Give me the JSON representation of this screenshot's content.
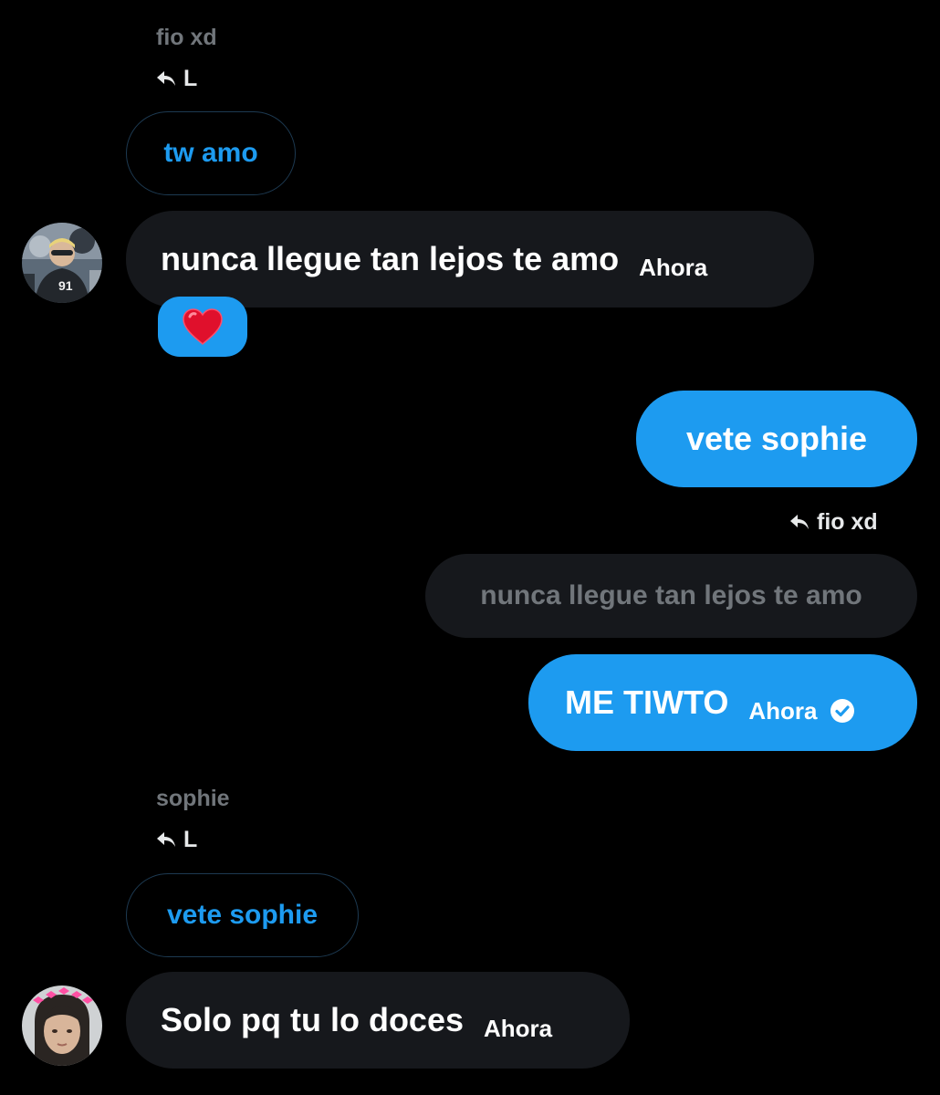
{
  "messages": [
    {
      "sender": "fio xd",
      "reply_to": "L",
      "quoted_text": "tw amo",
      "text": "nunca llegue tan lejos te amo",
      "time": "Ahora",
      "reaction": "❤️"
    },
    {
      "outgoing": true,
      "text": "vete sophie"
    },
    {
      "outgoing": true,
      "reply_to": "fio xd",
      "quoted_text": "nunca llegue tan lejos te amo",
      "text": "ME TIWTO",
      "time": "Ahora",
      "status_icon": "check-circle-icon"
    },
    {
      "sender": "sophie",
      "reply_to": "L",
      "quoted_text": "vete sophie",
      "text": "Solo pq tu lo doces",
      "time": "Ahora"
    }
  ],
  "colors": {
    "background": "#000000",
    "bubble_incoming": "#16181c",
    "bubble_outgoing": "#1d9bf0",
    "accent": "#1d9bf0",
    "muted_text": "#71767b"
  }
}
